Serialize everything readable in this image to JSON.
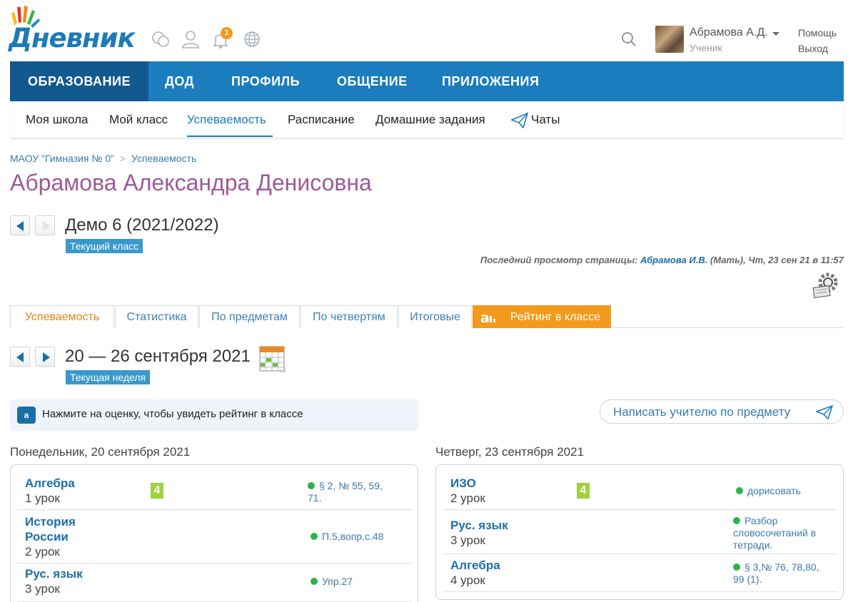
{
  "header": {
    "logo_text": "Дневник",
    "notification_count": "1",
    "user_name": "Абрамова А.Д.",
    "user_role": "Ученик",
    "help_label": "Помощь",
    "logout_label": "Выход"
  },
  "main_nav": [
    "ОБРАЗОВАНИЕ",
    "ДОД",
    "ПРОФИЛЬ",
    "ОБЩЕНИЕ",
    "ПРИЛОЖЕНИЯ"
  ],
  "sub_nav": [
    "Моя школа",
    "Мой класс",
    "Успеваемость",
    "Расписание",
    "Домашние задания",
    "Чаты"
  ],
  "breadcrumb": {
    "school": "МАОУ \"Гимназия № 0\"",
    "separator": ">",
    "current": "Успеваемость"
  },
  "page_title": "Абрамова Александра Денисовна",
  "class_selector": {
    "label": "Демо 6 (2021/2022)",
    "tag": "Текущий класс"
  },
  "last_view": {
    "prefix": "Последний просмотр страницы:",
    "who": "Абрамова И.В.",
    "suffix": "(Мать), Чт, 23 сен 21 в 11:57"
  },
  "tabs": [
    "Успеваемость",
    "Статистика",
    "По предметам",
    "По четвертям",
    "Итоговые",
    "Рейтинг в классе"
  ],
  "week_selector": {
    "label": "20 — 26 сентября 2021",
    "tag": "Текущая неделя"
  },
  "hint": {
    "icon_text": "a",
    "text": "Нажмите на оценку, чтобы увидеть рейтинг в классе"
  },
  "write_button": "Написать учителю по предмету",
  "days": [
    {
      "title": "Понедельник, 20 сентября 2021",
      "lessons": [
        {
          "subject": "Алгебра",
          "number": "1 урок",
          "grade": "4",
          "homework": "§ 2, № 55, 59,",
          "homework2": "71."
        },
        {
          "subject": "История",
          "subject2": "России",
          "number": "2 урок",
          "homework": "П.5,вопр.с.48"
        },
        {
          "subject": "Рус. язык",
          "number": "3 урок",
          "homework": "Упр.27"
        }
      ]
    },
    {
      "title": "Четверг, 23 сентября 2021",
      "lessons": [
        {
          "subject": "ИЗО",
          "number": "2 урок",
          "grade": "4",
          "homework": "дорисовать"
        },
        {
          "subject": "Рус. язык",
          "number": "3 урок",
          "homework": "Разбор",
          "homework2": "словосочетаний в",
          "homework3": "тетради."
        },
        {
          "subject": "Алгебра",
          "number": "4 урок",
          "homework": "§ 3,№ 76, 78,80,",
          "homework2": "99 (1)."
        }
      ]
    }
  ],
  "colors": {
    "brand_blue": "#1b7dbd",
    "nav_active": "#11598f",
    "title_purple": "#9d5a98",
    "rating_orange": "#f39a1c",
    "grade_green": "#9ed13a"
  }
}
